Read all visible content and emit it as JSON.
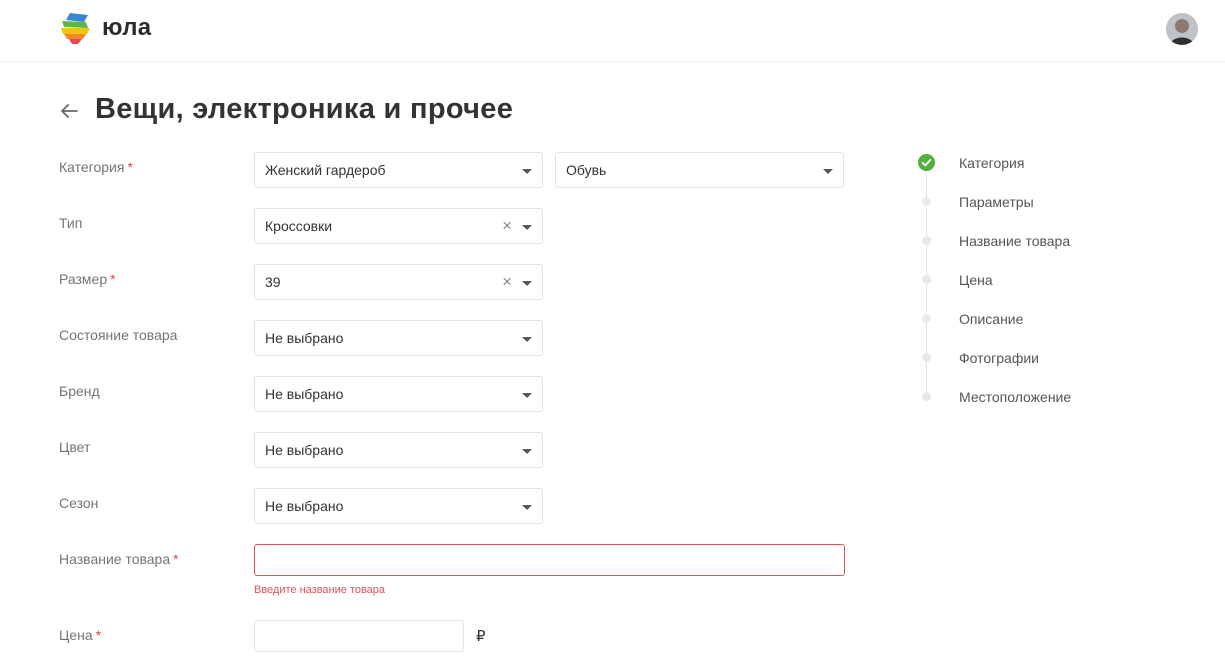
{
  "header": {
    "logo_text": "юла",
    "colors": {
      "logo_blue": "#3a86d6",
      "logo_green": "#5db84a",
      "logo_yellow": "#f2c318",
      "logo_orange": "#f08a24",
      "logo_red": "#e64b55"
    }
  },
  "page": {
    "title": "Вещи, электроника и прочее"
  },
  "form": {
    "category": {
      "label": "Категория",
      "required": "*",
      "value1": "Женский гардероб",
      "value2": "Обувь"
    },
    "type": {
      "label": "Тип",
      "value": "Кроссовки",
      "clear": "×"
    },
    "size": {
      "label": "Размер",
      "required": "*",
      "value": "39",
      "clear": "×"
    },
    "condition": {
      "label": "Состояние товара",
      "value": "Не выбрано"
    },
    "brand": {
      "label": "Бренд",
      "value": "Не выбрано"
    },
    "color": {
      "label": "Цвет",
      "value": "Не выбрано"
    },
    "season": {
      "label": "Сезон",
      "value": "Не выбрано"
    },
    "name": {
      "label": "Название товара",
      "required": "*",
      "value": "",
      "error": "Введите название товара"
    },
    "price": {
      "label": "Цена",
      "required": "*",
      "value": "",
      "currency": "₽"
    }
  },
  "steps": [
    {
      "label": "Категория",
      "status": "done"
    },
    {
      "label": "Параметры",
      "status": "pending"
    },
    {
      "label": "Название товара",
      "status": "pending"
    },
    {
      "label": "Цена",
      "status": "pending"
    },
    {
      "label": "Описание",
      "status": "pending"
    },
    {
      "label": "Фотографии",
      "status": "pending"
    },
    {
      "label": "Местоположение",
      "status": "pending"
    }
  ],
  "colors": {
    "accent_green": "#52b040",
    "error_red": "#d9545c",
    "required_red": "#e0434b"
  }
}
